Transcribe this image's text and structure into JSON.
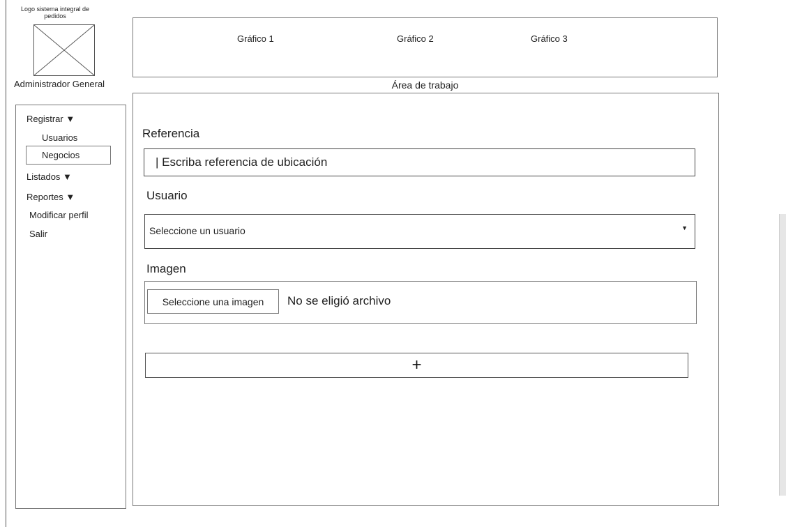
{
  "logo": {
    "caption": "Logo sistema integral de pedidos",
    "icon": "image-placeholder-icon"
  },
  "user_role": "Administrador General",
  "header": {
    "graphs": [
      "Gráfico 1",
      "Gráfico 2",
      "Gráfico 3"
    ]
  },
  "workspace_title": "Área de trabajo",
  "sidebar": {
    "registrar": "Registrar ▼",
    "usuarios": "Usuarios",
    "negocios": "Negocios",
    "listados": "Listados ▼",
    "reportes": "Reportes ▼",
    "modificar": "Modificar perfil",
    "salir": "Salir"
  },
  "form": {
    "referencia_label": "Referencia",
    "referencia_placeholder": "| Escriba referencia de ubicación",
    "usuario_label": "Usuario",
    "usuario_select": "Seleccione un usuario",
    "imagen_label": "Imagen",
    "file_button": "Seleccione una imagen",
    "file_status": "No se eligió archivo",
    "add_symbol": "+"
  },
  "colors": {
    "border": "#777777",
    "text": "#1a1a1a",
    "scrollbar": "#e6e6e6"
  }
}
